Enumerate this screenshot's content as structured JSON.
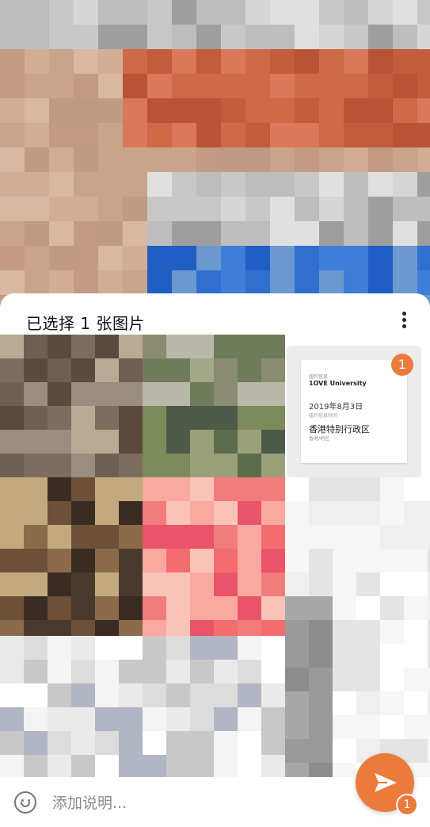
{
  "sheet": {
    "title": "已选择 1 张图片",
    "more_icon": "more-vertical-icon"
  },
  "selected_document": {
    "line1": "纽约信息",
    "line2": "1OVE University",
    "line3": "2019年8月3日",
    "line4": "纽约信息时间",
    "line5": "香港特别行政区",
    "line6": "香港/地区",
    "selection_count": "1"
  },
  "caption": {
    "placeholder": "添加说明...",
    "value": "",
    "emoji_icon": "emoji-icon"
  },
  "send": {
    "icon": "send-icon",
    "count": "1"
  },
  "colors": {
    "accent": "#ea7b3c",
    "sheet_bg": "#ffffff"
  }
}
